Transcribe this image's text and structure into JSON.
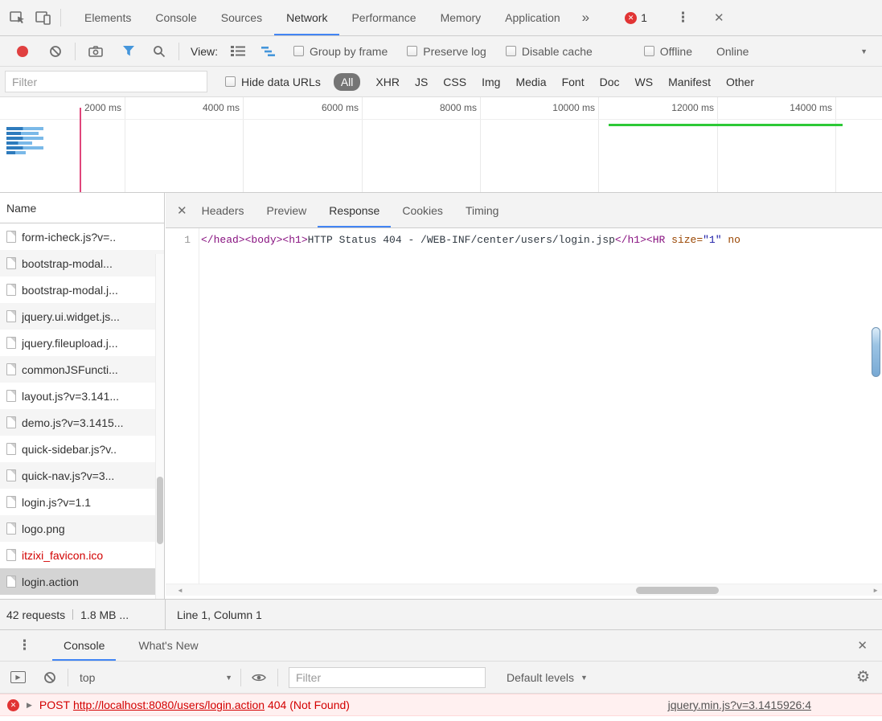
{
  "icons": {
    "error_x": "✕",
    "menu_dots": "⋮",
    "close": "✕",
    "dropdown_caret": "▼",
    "disclosure": "▶",
    "play": "▶",
    "gear": "⚙",
    "scroll_left": "◄",
    "scroll_right": "►"
  },
  "colors": {
    "accent_blue": "#4285f4",
    "error_red": "#d30000",
    "request_error_red": "#d20000",
    "overview_green": "#2dc937",
    "overview_pink": "#e0457b",
    "selected_row_bg": "#d4d4d4",
    "code_tag": "#881280",
    "code_attr": "#994500",
    "code_value": "#1a1aa6"
  },
  "main_tabs": {
    "items": [
      "Elements",
      "Console",
      "Sources",
      "Network",
      "Performance",
      "Memory",
      "Application"
    ],
    "active": "Network",
    "overflow": "»",
    "error_count": "1"
  },
  "network_toolbar": {
    "view_label": "View:",
    "group_by_frame": "Group by frame",
    "preserve_log": "Preserve log",
    "disable_cache": "Disable cache",
    "offline": "Offline",
    "throttling": "Online"
  },
  "filter_bar": {
    "filter_placeholder": "Filter",
    "hide_data_urls": "Hide data URLs",
    "types": [
      "All",
      "XHR",
      "JS",
      "CSS",
      "Img",
      "Media",
      "Font",
      "Doc",
      "WS",
      "Manifest",
      "Other"
    ],
    "active_type": "All"
  },
  "overview": {
    "time_labels": [
      "2000 ms",
      "4000 ms",
      "6000 ms",
      "8000 ms",
      "10000 ms",
      "12000 ms",
      "14000 ms"
    ]
  },
  "requests": {
    "column_header": "Name",
    "rows": [
      {
        "name": "form-icheck.js?v=.."
      },
      {
        "name": "bootstrap-modal..."
      },
      {
        "name": "bootstrap-modal.j..."
      },
      {
        "name": "jquery.ui.widget.js..."
      },
      {
        "name": "jquery.fileupload.j..."
      },
      {
        "name": "commonJSFuncti..."
      },
      {
        "name": "layout.js?v=3.141..."
      },
      {
        "name": "demo.js?v=3.1415..."
      },
      {
        "name": "quick-sidebar.js?v.."
      },
      {
        "name": "quick-nav.js?v=3..."
      },
      {
        "name": "login.js?v=1.1"
      },
      {
        "name": "logo.png"
      },
      {
        "name": "itzixi_favicon.ico"
      },
      {
        "name": "login.action"
      }
    ],
    "selected": "login.action",
    "error_row": "itzixi_favicon.ico"
  },
  "detail": {
    "tabs": [
      "Headers",
      "Preview",
      "Response",
      "Cookies",
      "Timing"
    ],
    "active_tab": "Response",
    "line_number": "1",
    "code": {
      "seg1": "</head><body><h1>",
      "seg2": "HTTP Status 404 - /WEB-INF/center/users/login.jsp",
      "seg3": "</h1><HR",
      "seg4": " size=",
      "seg5": "\"1\"",
      "seg6": " no"
    }
  },
  "status_bar": {
    "requests_count": "42 requests",
    "transferred": "1.8 MB ...",
    "cursor": "Line 1, Column 1"
  },
  "drawer": {
    "tabs": [
      "Console",
      "What's New"
    ],
    "active_tab": "Console"
  },
  "console_toolbar": {
    "context": "top",
    "filter_placeholder": "Filter",
    "levels": "Default levels"
  },
  "console_error": {
    "method": "POST",
    "url": "http://localhost:8080/users/login.action",
    "status": "404 (Not Found)",
    "source": "jquery.min.js?v=3.1415926:4"
  }
}
